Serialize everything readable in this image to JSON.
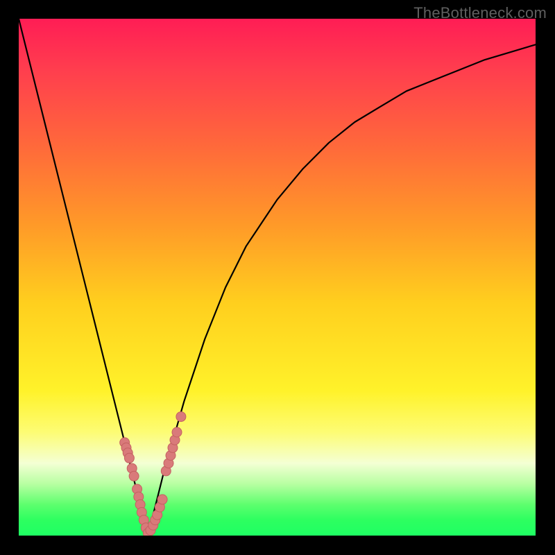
{
  "watermark": "TheBottleneck.com",
  "colors": {
    "gradient_top": "#ff1d55",
    "gradient_mid1": "#ff9a28",
    "gradient_mid2": "#fff22a",
    "gradient_bottom": "#1fff63",
    "curve_stroke": "#000000",
    "marker_fill": "#d97a7a",
    "marker_stroke": "#c46161",
    "frame_bg": "#000000"
  },
  "chart_data": {
    "type": "line",
    "title": "",
    "xlabel": "",
    "ylabel": "",
    "xlim": [
      0,
      100
    ],
    "ylim": [
      0,
      100
    ],
    "x": [
      0,
      2,
      4,
      6,
      8,
      10,
      12,
      14,
      16,
      18,
      20,
      22,
      23,
      24,
      25,
      26,
      27,
      28,
      30,
      32,
      34,
      36,
      38,
      40,
      42,
      44,
      46,
      48,
      50,
      55,
      60,
      65,
      70,
      75,
      80,
      85,
      90,
      95,
      100
    ],
    "series": [
      {
        "name": "bottleneck-curve",
        "values": [
          100,
          92,
          84,
          76,
          68,
          60,
          52,
          44,
          36,
          28,
          20,
          12,
          8,
          4,
          0,
          4,
          8,
          12,
          19,
          26,
          32,
          38,
          43,
          48,
          52,
          56,
          59,
          62,
          65,
          71,
          76,
          80,
          83,
          86,
          88,
          90,
          92,
          93.5,
          95
        ]
      }
    ],
    "markers": [
      {
        "x": 20.5,
        "y": 18
      },
      {
        "x": 20.8,
        "y": 17
      },
      {
        "x": 21.1,
        "y": 16
      },
      {
        "x": 21.4,
        "y": 15
      },
      {
        "x": 21.9,
        "y": 13
      },
      {
        "x": 22.3,
        "y": 11.5
      },
      {
        "x": 22.9,
        "y": 9
      },
      {
        "x": 23.2,
        "y": 7.5
      },
      {
        "x": 23.5,
        "y": 6
      },
      {
        "x": 23.8,
        "y": 4.5
      },
      {
        "x": 24.2,
        "y": 3
      },
      {
        "x": 24.6,
        "y": 1.5
      },
      {
        "x": 25.0,
        "y": 0.5
      },
      {
        "x": 25.5,
        "y": 1
      },
      {
        "x": 26.0,
        "y": 2
      },
      {
        "x": 26.4,
        "y": 3
      },
      {
        "x": 26.8,
        "y": 4
      },
      {
        "x": 27.3,
        "y": 5.5
      },
      {
        "x": 27.8,
        "y": 7
      },
      {
        "x": 28.5,
        "y": 12.5
      },
      {
        "x": 29.0,
        "y": 14
      },
      {
        "x": 29.4,
        "y": 15.5
      },
      {
        "x": 29.8,
        "y": 17
      },
      {
        "x": 30.2,
        "y": 18.5
      },
      {
        "x": 30.6,
        "y": 20
      },
      {
        "x": 31.4,
        "y": 23
      }
    ],
    "notes": "V-shaped bottleneck curve overlaid on a vertical red-to-green gradient. Values estimated from pixel positions; no axis ticks or labels are shown in the source image."
  }
}
